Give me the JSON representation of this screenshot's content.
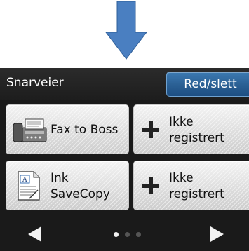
{
  "indicator": {
    "icon": "down-arrow-icon",
    "color": "#4a7fc1"
  },
  "header": {
    "title": "Snarveier",
    "edit_label": "Red/slett"
  },
  "shortcuts": [
    {
      "label_line1": "Fax to Boss",
      "label_line2": "",
      "icon": "fax-machine-icon"
    },
    {
      "label_line1": "Ikke",
      "label_line2": "registrert",
      "icon": "plus-icon"
    },
    {
      "label_line1": "Ink",
      "label_line2": "SaveCopy",
      "icon": "document-icon"
    },
    {
      "label_line1": "Ikke",
      "label_line2": "registrert",
      "icon": "plus-icon"
    }
  ],
  "pagination": {
    "current_page": 1,
    "total_pages": 3
  }
}
